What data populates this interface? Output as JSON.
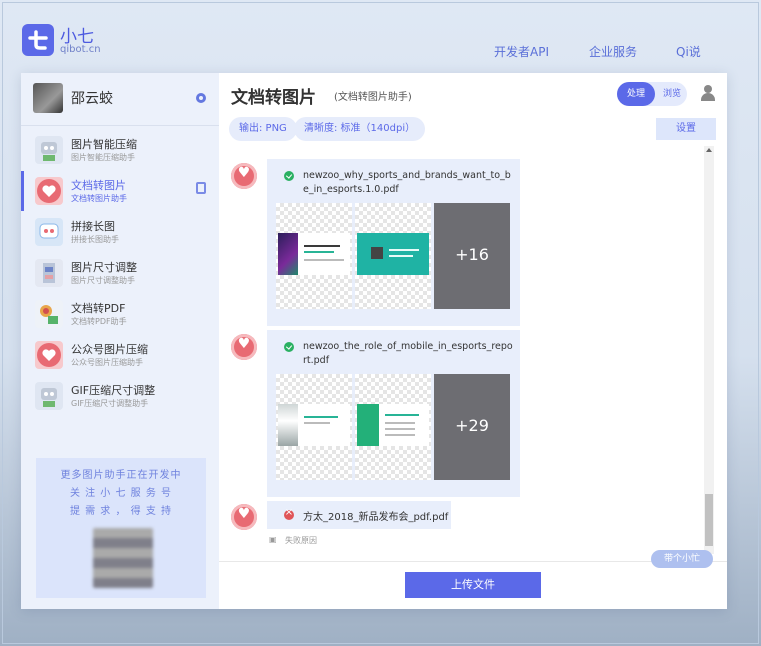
{
  "header": {
    "logo_title": "小七",
    "logo_sub": "qibot.cn",
    "nav": [
      "开发者API",
      "企业服务",
      "Qi说"
    ]
  },
  "sidebar": {
    "user_name": "邵云蛟",
    "items": [
      {
        "title": "图片智能压缩",
        "sub": "图片智能压缩助手"
      },
      {
        "title": "文档转图片",
        "sub": "文档转图片助手"
      },
      {
        "title": "拼接长图",
        "sub": "拼接长图助手"
      },
      {
        "title": "图片尺寸调整",
        "sub": "图片尺寸调整助手"
      },
      {
        "title": "文档转PDF",
        "sub": "文档转PDF助手"
      },
      {
        "title": "公众号图片压缩",
        "sub": "公众号图片压缩助手"
      },
      {
        "title": "GIF压缩尺寸调整",
        "sub": "GIF压缩尺寸调整助手"
      }
    ],
    "promo": [
      "更多图片助手正在开发中",
      "关 注 小 七 服 务 号",
      "提 需 求 ， 得 支 持"
    ]
  },
  "main": {
    "title": "文档转图片",
    "subtitle": "(文档转图片助手)",
    "toggle_on": "处理",
    "toggle_off": "浏览",
    "chip_output": "输出: PNG",
    "chip_quality": "清晰度: 标准（140dpi）",
    "settings": "设置",
    "messages": [
      {
        "filename": "newzoo_why_sports_and_brands_want_to_be_in_esports.1.0.pdf",
        "more": "+16",
        "status": "success"
      },
      {
        "filename": "newzoo_the_role_of_mobile_in_esports_report.pdf",
        "more": "+29",
        "status": "success"
      },
      {
        "filename": "方太_2018_新品发布会_pdf.pdf",
        "status": "error",
        "reason": "失败原因"
      }
    ],
    "upload": "上传文件",
    "float_btn": "带个小忙"
  },
  "colors": {
    "accent": "#5b69e8",
    "success": "#2ab062",
    "error": "#e05558"
  }
}
